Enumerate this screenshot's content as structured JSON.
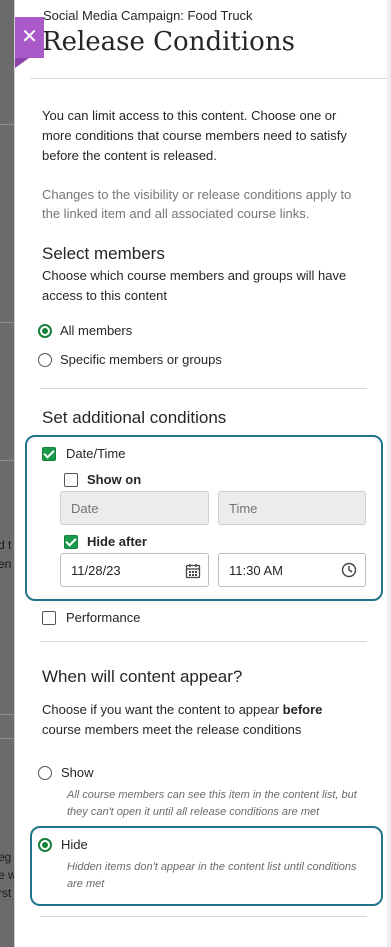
{
  "background": {
    "fragments": [
      "d t",
      "en",
      "eg",
      "e w",
      "rst"
    ]
  },
  "panel": {
    "close_icon": "close-icon",
    "breadcrumb": "Social Media Campaign: Food Truck",
    "title": "Release Conditions"
  },
  "intro": {
    "line1": "You can limit access to this content. Choose one or",
    "line2": "more conditions that course members need to satisfy",
    "line3": "before the content is released.",
    "note1": "Changes to the visibility or release conditions apply to",
    "note2": "the linked item and all associated course links."
  },
  "members": {
    "heading": "Select members",
    "desc1": "Choose which course members and groups will have",
    "desc2": "access to this content",
    "options": [
      {
        "label": "All members",
        "selected": true
      },
      {
        "label": "Specific members or groups",
        "selected": false
      }
    ]
  },
  "conditions": {
    "heading": "Set additional conditions",
    "datetime": {
      "label": "Date/Time",
      "checked": true,
      "show_on": {
        "label": "Show on",
        "checked": false,
        "date_placeholder": "Date",
        "time_placeholder": "Time"
      },
      "hide_after": {
        "label": "Hide after",
        "checked": true,
        "date_value": "11/28/23",
        "time_value": "11:30 AM",
        "date_icon": "calendar-icon",
        "time_icon": "clock-icon"
      }
    },
    "performance": {
      "label": "Performance",
      "checked": false
    }
  },
  "appear": {
    "heading": "When will content appear?",
    "desc1_pre": "Choose if you want the content to appear ",
    "desc1_bold": "before",
    "desc2": "course members meet the release conditions",
    "options": [
      {
        "label": "Show",
        "selected": false,
        "help1": "All course members can see this item in the content list, but",
        "help2": "they can't open it until all release conditions are met"
      },
      {
        "label": "Hide",
        "selected": true,
        "help1": "Hidden items don't appear in the content list until conditions",
        "help2": "are met"
      }
    ]
  },
  "colors": {
    "accent_purple": "#a95ac8",
    "check_green": "#1a9a4b",
    "focus_teal": "#22748a"
  }
}
